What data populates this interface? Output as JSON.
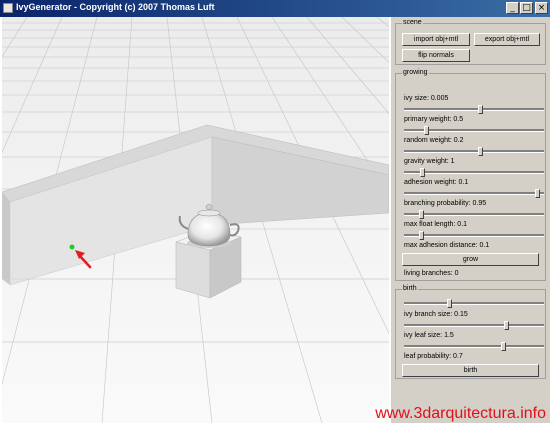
{
  "window": {
    "title": "IvyGenerator - Copyright (c) 2007 Thomas Luft",
    "min_glyph": "_",
    "max_glyph": "□",
    "close_glyph": "×"
  },
  "scene": {
    "label": "scene",
    "import_label": "import obj+mtl",
    "export_label": "export obj+mtl",
    "flip_label": "flip normals"
  },
  "growing": {
    "label": "growing",
    "params": [
      {
        "label": "ivy size: 0.005",
        "value": 0.55
      },
      {
        "label": "primary weight: 0.5",
        "value": 0.15
      },
      {
        "label": "random weight: 0.2",
        "value": 0.55
      },
      {
        "label": "gravity weight: 1",
        "value": 0.12
      },
      {
        "label": "adhesion weight: 0.1",
        "value": 0.97
      },
      {
        "label": "branching probability: 0.95",
        "value": 0.11
      },
      {
        "label": "max float length: 0.1",
        "value": 0.11
      }
    ],
    "max_adhesion_label": "max adhesion distance: 0.1",
    "grow_label": "grow",
    "living_branches": "living branches: 0"
  },
  "birth": {
    "label": "birth",
    "params": [
      {
        "label": "",
        "value": 0.32
      },
      {
        "label": "ivy branch size: 0.15",
        "value": 0.74
      },
      {
        "label": "ivy leaf size: 1.5",
        "value": 0.72
      },
      {
        "label": "leaf probability: 0.7",
        "value": 0
      }
    ],
    "birth_label": "birth"
  },
  "watermark": "www.3darquitectura.info",
  "colors": {
    "title_start": "#0a246a",
    "title_end": "#3a6ea5",
    "panel_bg": "#d4d0c8",
    "watermark": "#e0101a",
    "marker": "#22cc22",
    "arrow": "#e02020"
  },
  "icons": [
    "app-icon",
    "minimize-icon",
    "maximize-icon",
    "close-icon",
    "arrow-icon"
  ]
}
